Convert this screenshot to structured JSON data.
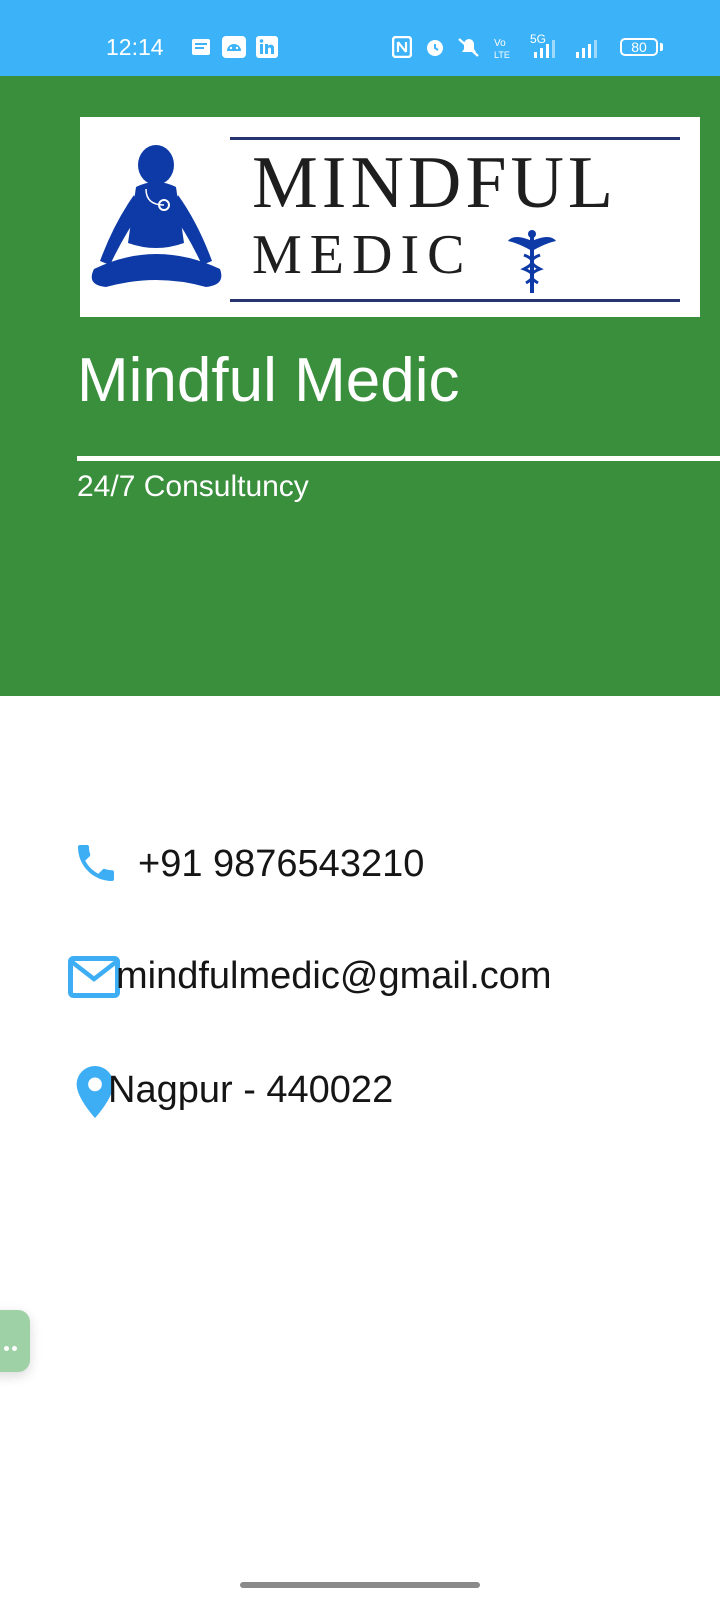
{
  "status_bar": {
    "time": "12:14",
    "battery": "80",
    "network": "5G",
    "left_icons": [
      "message-icon",
      "android-icon",
      "linkedin-icon"
    ],
    "right_icons": [
      "nfc-icon",
      "alarm-icon",
      "mute-icon",
      "volte-icon",
      "signal-icon",
      "signal-icon",
      "battery-icon"
    ]
  },
  "header": {
    "logo_word_1": "MINDFUL",
    "logo_word_2": "MEDIC",
    "title": "Mindful Medic",
    "subtitle": "24/7 Consultuncy",
    "background_color": "#3a8f3d"
  },
  "contacts": {
    "phone": "+91 9876543210",
    "email": "mindfulmedic@gmail.com",
    "location": "Nagpur - 440022",
    "icon_color": "#3eaef4"
  },
  "colors": {
    "status_bar": "#3cb3f9",
    "logo_blue": "#0d3aa6"
  }
}
